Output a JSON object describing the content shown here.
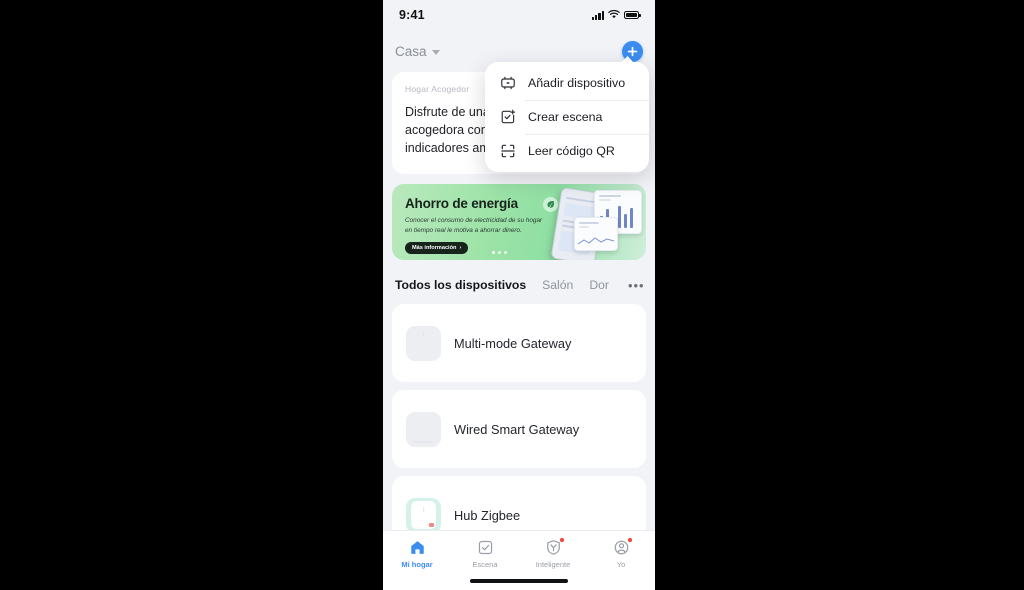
{
  "status_bar": {
    "time": "9:41",
    "signal_icon": "cellular-signal-icon",
    "wifi_icon": "wifi-icon",
    "battery_icon": "battery-icon"
  },
  "header": {
    "home_name": "Casa",
    "dropdown_caret": "chevron-down-icon",
    "add_button": "plus-icon"
  },
  "cozy_card": {
    "title": "Hogar Acogedor",
    "line1": "Disfrute de una",
    "line2": "acogedora con",
    "line3": "indicadores am"
  },
  "banner": {
    "heading": "Ahorro de energía",
    "paragraph": "Conocer el consumo de electricidad de su hogar en tiempo real le motiva a ahorrar dinero.",
    "cta": "Más información",
    "cta_chevron": "›",
    "leaf_icon": "leaf-icon"
  },
  "tabs": {
    "items": [
      {
        "label": "Todos los dispositivos",
        "active": true
      },
      {
        "label": "Salón",
        "active": false
      },
      {
        "label": "Dor",
        "active": false
      }
    ],
    "more": "•••"
  },
  "devices": [
    {
      "name": "Multi-mode Gateway",
      "thumb": "gateway-white"
    },
    {
      "name": "Wired Smart Gateway",
      "thumb": "gateway-wired"
    },
    {
      "name": "Hub Zigbee",
      "thumb": "hub-zigbee-mint"
    }
  ],
  "menu": {
    "items": [
      {
        "label": "Añadir dispositivo",
        "icon": "add-device-icon"
      },
      {
        "label": "Crear escena",
        "icon": "create-scene-icon"
      },
      {
        "label": "Leer código QR",
        "icon": "qr-scan-icon"
      }
    ]
  },
  "tabbar": {
    "items": [
      {
        "label": "Mi hogar",
        "icon": "home-icon",
        "active": true,
        "badge": false
      },
      {
        "label": "Escena",
        "icon": "checkbox-icon",
        "active": false,
        "badge": false
      },
      {
        "label": "Inteligente",
        "icon": "smart-icon",
        "active": false,
        "badge": true
      },
      {
        "label": "Yo",
        "icon": "profile-icon",
        "active": false,
        "badge": true
      }
    ]
  },
  "colors": {
    "accent": "#3c8cf0",
    "background": "#f2f3f7",
    "card": "#ffffff",
    "banner_green": "#9ee3a8",
    "badge_red": "#f4483b",
    "mint": "#d4f2ea"
  }
}
